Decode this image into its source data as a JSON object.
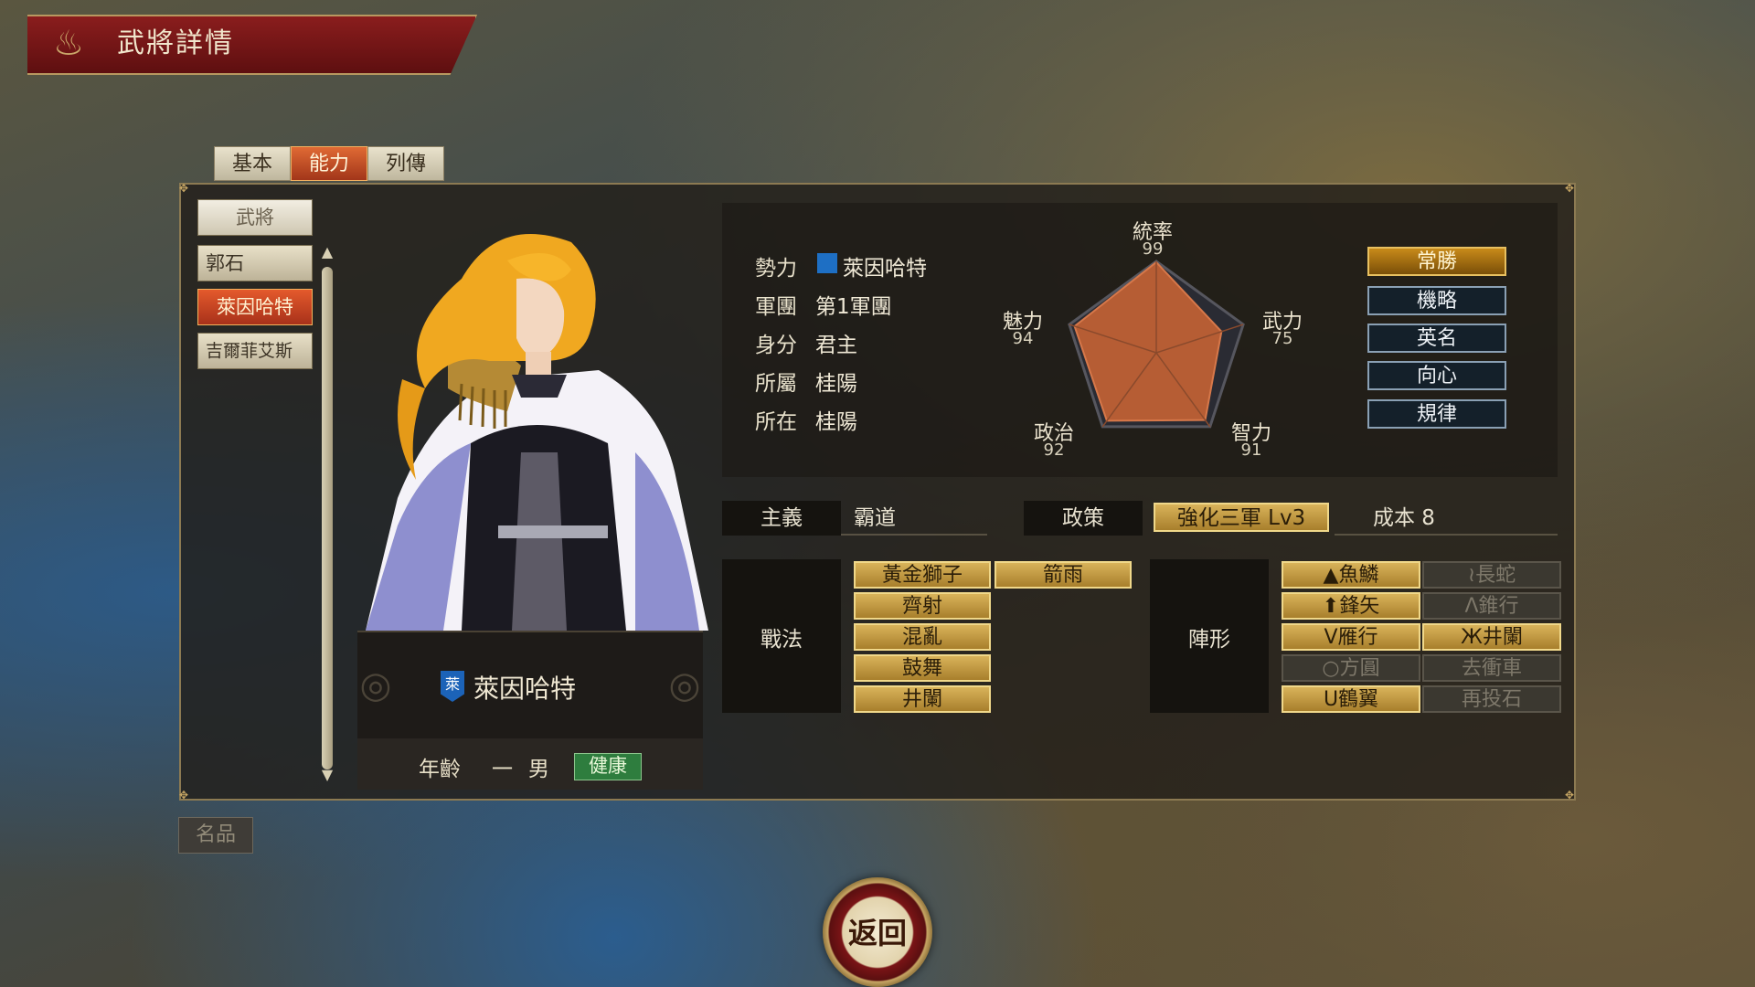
{
  "header": {
    "title": "武將詳情"
  },
  "tabs": [
    {
      "label": "基本",
      "active": false
    },
    {
      "label": "能力",
      "active": true
    },
    {
      "label": "列傳",
      "active": false
    }
  ],
  "sidebar": {
    "header": "武將",
    "items": [
      {
        "label": "郭石",
        "selected": false
      },
      {
        "label": "萊因哈特",
        "selected": true
      },
      {
        "label": "吉爾菲艾斯",
        "selected": false
      }
    ]
  },
  "character": {
    "name": "萊因哈特",
    "badge": "萊",
    "age_label": "年齡",
    "age": "一",
    "sex": "男",
    "health": "健康"
  },
  "info": {
    "rows": [
      {
        "label": "勢力",
        "value": "萊因哈特"
      },
      {
        "label": "軍團",
        "value": "第1軍團"
      },
      {
        "label": "身分",
        "value": "君主"
      },
      {
        "label": "所屬",
        "value": "桂陽"
      },
      {
        "label": "所在",
        "value": "桂陽"
      }
    ],
    "faction_color": "#1e6fc4"
  },
  "stats": [
    {
      "name": "統率",
      "value": 99
    },
    {
      "name": "武力",
      "value": 75
    },
    {
      "name": "智力",
      "value": 91
    },
    {
      "name": "政治",
      "value": 92
    },
    {
      "name": "魅力",
      "value": 94
    }
  ],
  "traits": [
    {
      "label": "常勝",
      "highlight": true
    },
    {
      "label": "機略",
      "highlight": false
    },
    {
      "label": "英名",
      "highlight": false
    },
    {
      "label": "向心",
      "highlight": false
    },
    {
      "label": "規律",
      "highlight": false
    }
  ],
  "policy": {
    "ideology_label": "主義",
    "ideology": "霸道",
    "policy_label": "政策",
    "policy": "強化三軍 Lv3",
    "cost_label": "成本 8"
  },
  "tactics": {
    "label": "戰法",
    "skills": [
      "黃金獅子",
      "箭雨",
      "齊射",
      "混亂",
      "鼓舞",
      "井闌"
    ]
  },
  "formation": {
    "label": "陣形",
    "items": [
      {
        "label": "▲魚鱗",
        "enabled": true
      },
      {
        "label": "≀長蛇",
        "enabled": false
      },
      {
        "label": "⬆鋒矢",
        "enabled": true
      },
      {
        "label": "Λ錐行",
        "enabled": false
      },
      {
        "label": "V雁行",
        "enabled": true
      },
      {
        "label": "Ж井闌",
        "enabled": true
      },
      {
        "label": "○方圓",
        "enabled": false
      },
      {
        "label": "去衝車",
        "enabled": false
      },
      {
        "label": "U鶴翼",
        "enabled": true
      },
      {
        "label": "再投石",
        "enabled": false
      }
    ]
  },
  "bottom": {
    "item_button": "名品",
    "back_button": "返回"
  },
  "colors": {
    "accent_red": "#a8311a",
    "gold": "#d9b35a",
    "panel": "#221e1a"
  }
}
